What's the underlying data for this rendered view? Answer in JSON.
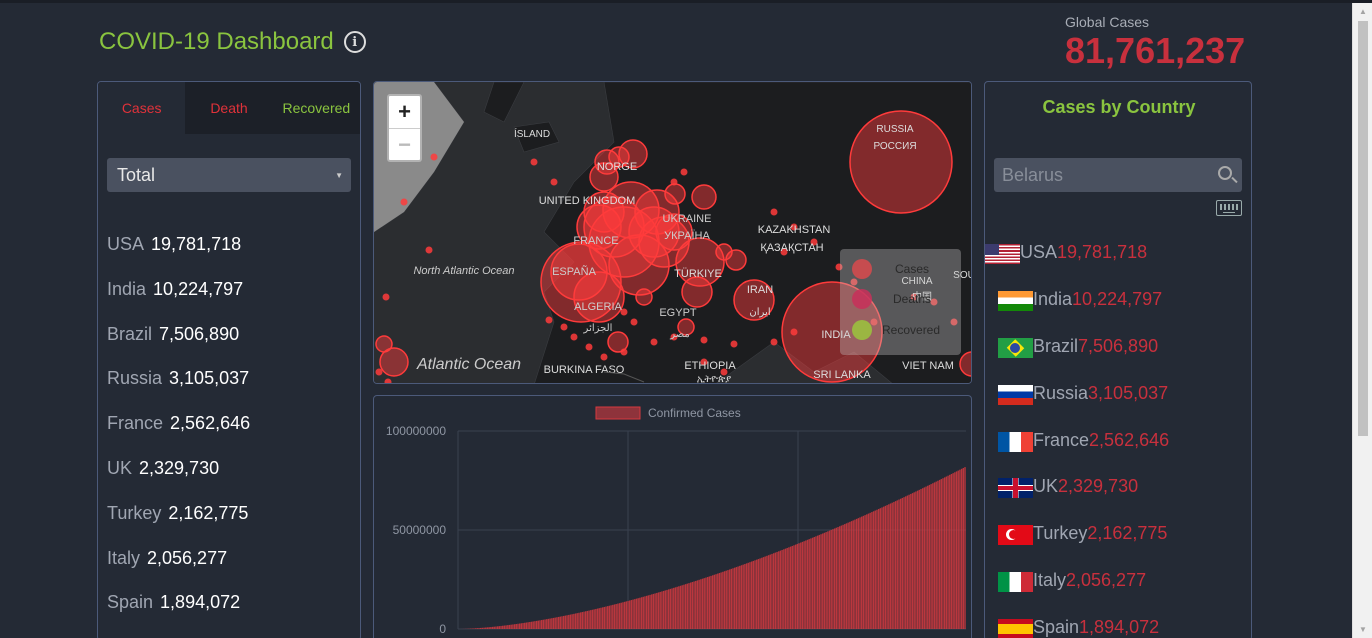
{
  "header": {
    "title": "COVID-19 Dashboard",
    "global_label": "Global Cases",
    "global_value": "81,761,237"
  },
  "left": {
    "tabs": [
      {
        "label": "Cases"
      },
      {
        "label": "Death"
      },
      {
        "label": "Recovered"
      }
    ],
    "select_value": "Total",
    "countries": [
      {
        "name": "USA",
        "value": "19,781,718"
      },
      {
        "name": "India",
        "value": "10,224,797"
      },
      {
        "name": "Brazil",
        "value": "7,506,890"
      },
      {
        "name": "Russia",
        "value": "3,105,037"
      },
      {
        "name": "France",
        "value": "2,562,646"
      },
      {
        "name": "UK",
        "value": "2,329,730"
      },
      {
        "name": "Turkey",
        "value": "2,162,775"
      },
      {
        "name": "Italy",
        "value": "2,056,277"
      },
      {
        "name": "Spain",
        "value": "1,894,072"
      }
    ]
  },
  "map": {
    "zoom_in": "+",
    "zoom_out": "−",
    "labels": [
      "ÍSLAND",
      "NORGE",
      "UNITED KINGDOM",
      "FRANCE",
      "ESPAÑA",
      "UKRAINE",
      "УКРАЇНА",
      "TÜRKIYE",
      "KAZAKHSTAN",
      "ҚАЗАҚСТАН",
      "RUSSIA",
      "РОССИЯ",
      "CHINA",
      "中国",
      "IRAN",
      "ایران",
      "INDIA",
      "SRI LANKA",
      "VIET NAM",
      "ALGERIA",
      "الجزائر",
      "EGYPT",
      "مصر",
      "ETHIOPIA",
      "ኢትዮጵያ",
      "BURKINA FASO",
      "North Atlantic Ocean",
      "Atlantic Ocean",
      "SOU"
    ],
    "legend": [
      {
        "label": "Cases",
        "color": "#d94a4e"
      },
      {
        "label": "Deaths",
        "color": "#c8305a"
      },
      {
        "label": "Recovered",
        "color": "#9bc53d"
      }
    ],
    "colors": {
      "circle": "#ff3b3b",
      "land": "#1e1f21",
      "water": "#2b2d30"
    }
  },
  "chart_data": {
    "type": "bar",
    "legend": "Confirmed Cases",
    "yticks": [
      "100000000",
      "50000000",
      "0"
    ],
    "ylim": [
      0,
      100000000
    ],
    "series": [
      {
        "name": "Confirmed Cases",
        "start": 0,
        "end": 81761237,
        "points": 300
      }
    ],
    "color": "#d63a3f"
  },
  "right": {
    "title": "Cases by Country",
    "search_placeholder": "Belarus",
    "countries": [
      {
        "name": "USA",
        "value": "19,781,718",
        "flag": "us"
      },
      {
        "name": "India",
        "value": "10,224,797",
        "flag": "in"
      },
      {
        "name": "Brazil",
        "value": "7,506,890",
        "flag": "br"
      },
      {
        "name": "Russia",
        "value": "3,105,037",
        "flag": "ru"
      },
      {
        "name": "France",
        "value": "2,562,646",
        "flag": "fr"
      },
      {
        "name": "UK",
        "value": "2,329,730",
        "flag": "gb"
      },
      {
        "name": "Turkey",
        "value": "2,162,775",
        "flag": "tr"
      },
      {
        "name": "Italy",
        "value": "2,056,277",
        "flag": "it"
      },
      {
        "name": "Spain",
        "value": "1,894,072",
        "flag": "es"
      }
    ]
  }
}
